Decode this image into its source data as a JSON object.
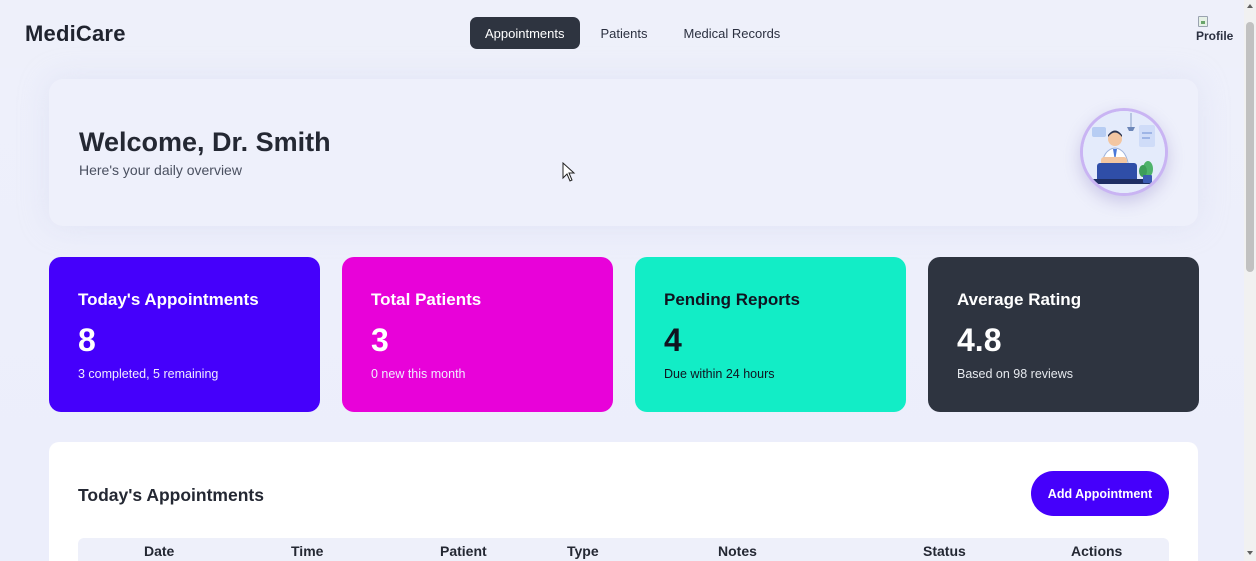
{
  "brand": "MediCare",
  "nav": {
    "tabs": [
      {
        "label": "Appointments",
        "active": true
      },
      {
        "label": "Patients",
        "active": false
      },
      {
        "label": "Medical Records",
        "active": false
      }
    ]
  },
  "profile": {
    "alt_text": "Profile"
  },
  "welcome": {
    "title": "Welcome, Dr. Smith",
    "subtitle": "Here's your daily overview"
  },
  "stats": [
    {
      "title": "Today's Appointments",
      "value": "8",
      "sub": "3 completed, 5 remaining",
      "color": "#4500fb"
    },
    {
      "title": "Total Patients",
      "value": "3",
      "sub": "0 new this month",
      "color": "#e802d9"
    },
    {
      "title": "Pending Reports",
      "value": "4",
      "sub": "Due within 24 hours",
      "color": "#12edc6"
    },
    {
      "title": "Average Rating",
      "value": "4.8",
      "sub": "Based on 98 reviews",
      "color": "#2e3440"
    }
  ],
  "appointments": {
    "title": "Today's Appointments",
    "add_button": "Add Appointment",
    "columns": [
      "Date",
      "Time",
      "Patient",
      "Type",
      "Notes",
      "Status",
      "Actions"
    ]
  },
  "colors": {
    "accent": "#4500fb",
    "background": "#eef0fa",
    "nav_active": "#2e3440"
  }
}
